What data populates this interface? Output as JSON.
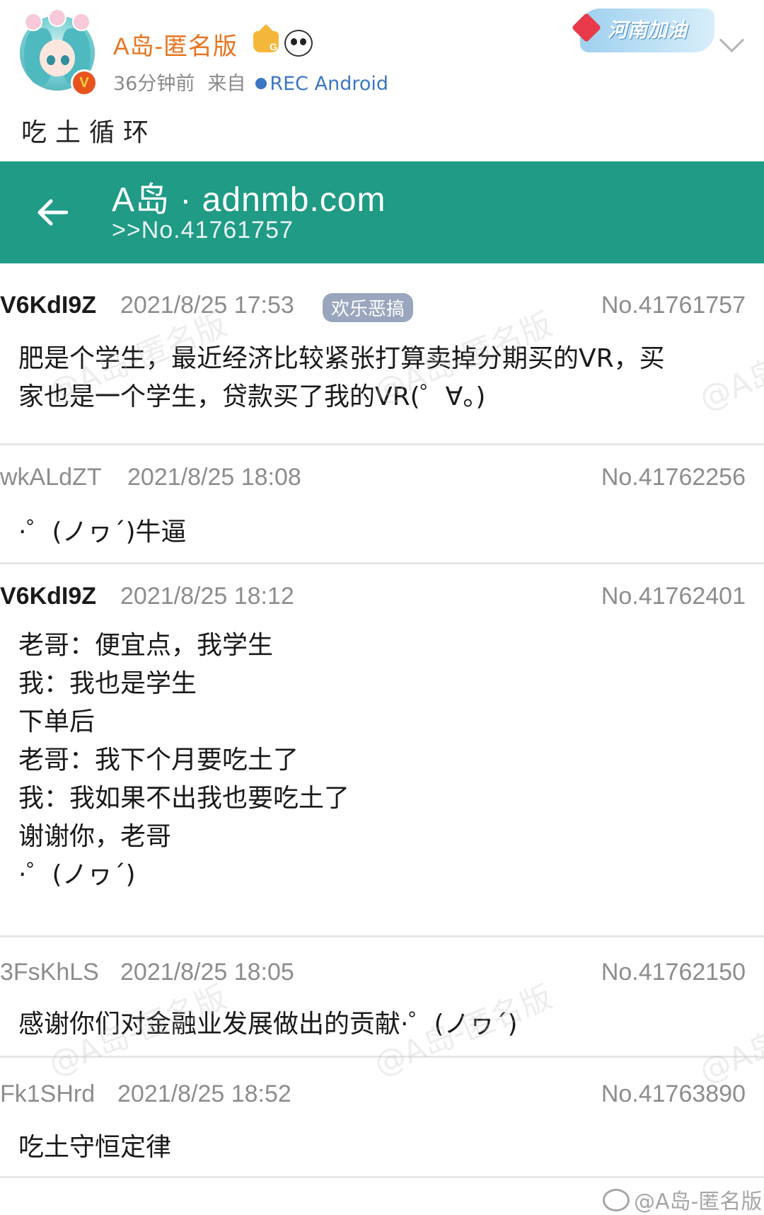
{
  "post": {
    "user_name": "A岛-匿名版",
    "verified_badge": "V",
    "crown_badge_text": "G",
    "time_ago": "36分钟前",
    "from_label": "来自",
    "source": "REC",
    "source_device": "Android",
    "campaign_badge": "河南加油",
    "text": "吃土循环"
  },
  "app_bar": {
    "title": "A岛 · adnmb.com",
    "subtitle": ">>No.41761757"
  },
  "replies": [
    {
      "uid": "V6KdI9Z",
      "time": "2021/8/25 17:53",
      "tag": "欢乐恶搞",
      "no": "No.41761757",
      "content": "肥是个学生，最近经济比较紧张打算卖掉分期买的VR，买\n家也是一个学生，贷款买了我的VR(゜∀。)"
    },
    {
      "uid": "wkALdZT",
      "time": "2021/8/25 18:08",
      "no": "No.41762256",
      "content": "·゜(ノヮ´)牛逼"
    },
    {
      "uid": "V6KdI9Z",
      "time": "2021/8/25 18:12",
      "no": "No.41762401",
      "content": "老哥：便宜点，我学生\n我：我也是学生\n下单后\n老哥：我下个月要吃土了\n我：我如果不出我也要吃土了\n谢谢你，老哥\n·゜(ノヮ´)"
    },
    {
      "uid": "3FsKhLS",
      "time": "2021/8/25 18:05",
      "no": "No.41762150",
      "content": "感谢你们对金融业发展做出的贡献·゜(ノヮ´)"
    },
    {
      "uid": "Fk1SHrd",
      "time": "2021/8/25 18:52",
      "no": "No.41763890",
      "content": "吃土守恒定律"
    }
  ],
  "watermark": "@A岛-匿名版",
  "weibo_watermark": "@A岛-匿名版",
  "colors": {
    "app_bar": "#1f9b86",
    "username": "#e8741e",
    "source_link": "#3b76c4",
    "tag_bg": "#9aa6bd"
  }
}
